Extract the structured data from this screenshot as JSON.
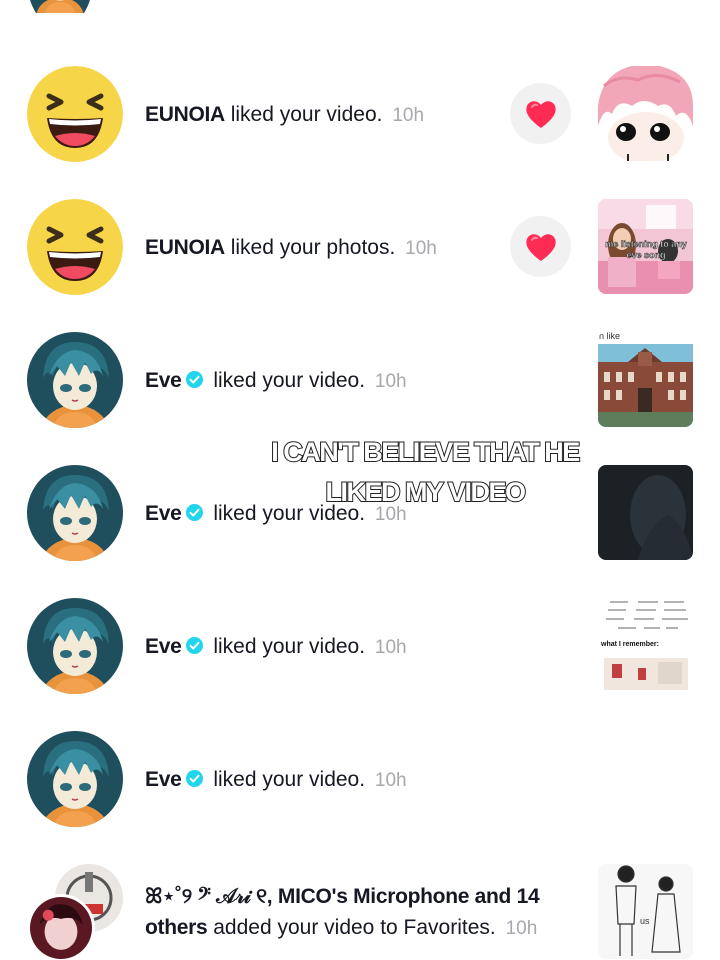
{
  "notifications": [
    {
      "name": "EUNOIA",
      "action": "liked your video.",
      "time": "10h",
      "verified": false,
      "avatar": "laughing-emoji-avatar",
      "has_like_button": true,
      "thumbnail": "pink-hair-character-thumbnail"
    },
    {
      "name": "EUNOIA",
      "action": "liked your photos.",
      "time": "10h",
      "verified": false,
      "avatar": "laughing-emoji-avatar",
      "has_like_button": true,
      "thumbnail": "pink-room-thumbnail",
      "thumbnail_text": "me listening to any eve song"
    },
    {
      "name": "Eve",
      "action": "liked your video.",
      "time": "10h",
      "verified": true,
      "avatar": "anime-boy-avatar",
      "thumbnail": "building-thumbnail",
      "thumbnail_text": "n like"
    },
    {
      "name": "Eve",
      "action": "liked your video.",
      "time": "10h",
      "verified": true,
      "avatar": "anime-boy-avatar",
      "thumbnail": "dark-video-thumbnail"
    },
    {
      "name": "Eve",
      "action": "liked your video.",
      "time": "10h",
      "verified": true,
      "avatar": "anime-boy-avatar",
      "thumbnail": "math-meme-thumbnail",
      "thumbnail_text": "what I remember:"
    },
    {
      "name": "Eve",
      "action": "liked your video.",
      "time": "10h",
      "verified": true,
      "avatar": "anime-boy-avatar"
    },
    {
      "name_line1": "ꕤ⋆˚୨ 𝄢 𝒜𝓇𝒾 ୧, MICO's Microphone and 14",
      "name_line2": "others",
      "action": "added your video to Favorites.",
      "time": "10h",
      "avatar": "stacked-avatars",
      "thumbnail": "sketch-couple-thumbnail",
      "thumbnail_text": "us"
    }
  ],
  "overlay_caption": {
    "line1": "I CAN'T BELIEVE THAT HE",
    "line2": "LIKED MY VIDEO"
  },
  "colors": {
    "verified": "#20d5ec",
    "heart": "#fe2c55",
    "time": "#a7a8ad",
    "like_button_bg": "#f1f1f2"
  }
}
